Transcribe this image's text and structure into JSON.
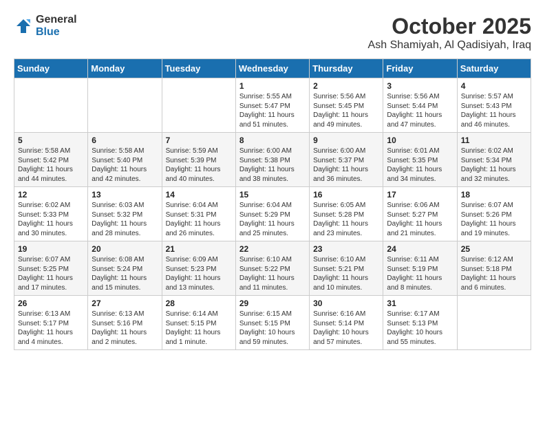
{
  "header": {
    "logo_general": "General",
    "logo_blue": "Blue",
    "month_title": "October 2025",
    "location": "Ash Shamiyah, Al Qadisiyah, Iraq"
  },
  "weekdays": [
    "Sunday",
    "Monday",
    "Tuesday",
    "Wednesday",
    "Thursday",
    "Friday",
    "Saturday"
  ],
  "weeks": [
    [
      {
        "day": "",
        "info": ""
      },
      {
        "day": "",
        "info": ""
      },
      {
        "day": "",
        "info": ""
      },
      {
        "day": "1",
        "info": "Sunrise: 5:55 AM\nSunset: 5:47 PM\nDaylight: 11 hours\nand 51 minutes."
      },
      {
        "day": "2",
        "info": "Sunrise: 5:56 AM\nSunset: 5:45 PM\nDaylight: 11 hours\nand 49 minutes."
      },
      {
        "day": "3",
        "info": "Sunrise: 5:56 AM\nSunset: 5:44 PM\nDaylight: 11 hours\nand 47 minutes."
      },
      {
        "day": "4",
        "info": "Sunrise: 5:57 AM\nSunset: 5:43 PM\nDaylight: 11 hours\nand 46 minutes."
      }
    ],
    [
      {
        "day": "5",
        "info": "Sunrise: 5:58 AM\nSunset: 5:42 PM\nDaylight: 11 hours\nand 44 minutes."
      },
      {
        "day": "6",
        "info": "Sunrise: 5:58 AM\nSunset: 5:40 PM\nDaylight: 11 hours\nand 42 minutes."
      },
      {
        "day": "7",
        "info": "Sunrise: 5:59 AM\nSunset: 5:39 PM\nDaylight: 11 hours\nand 40 minutes."
      },
      {
        "day": "8",
        "info": "Sunrise: 6:00 AM\nSunset: 5:38 PM\nDaylight: 11 hours\nand 38 minutes."
      },
      {
        "day": "9",
        "info": "Sunrise: 6:00 AM\nSunset: 5:37 PM\nDaylight: 11 hours\nand 36 minutes."
      },
      {
        "day": "10",
        "info": "Sunrise: 6:01 AM\nSunset: 5:35 PM\nDaylight: 11 hours\nand 34 minutes."
      },
      {
        "day": "11",
        "info": "Sunrise: 6:02 AM\nSunset: 5:34 PM\nDaylight: 11 hours\nand 32 minutes."
      }
    ],
    [
      {
        "day": "12",
        "info": "Sunrise: 6:02 AM\nSunset: 5:33 PM\nDaylight: 11 hours\nand 30 minutes."
      },
      {
        "day": "13",
        "info": "Sunrise: 6:03 AM\nSunset: 5:32 PM\nDaylight: 11 hours\nand 28 minutes."
      },
      {
        "day": "14",
        "info": "Sunrise: 6:04 AM\nSunset: 5:31 PM\nDaylight: 11 hours\nand 26 minutes."
      },
      {
        "day": "15",
        "info": "Sunrise: 6:04 AM\nSunset: 5:29 PM\nDaylight: 11 hours\nand 25 minutes."
      },
      {
        "day": "16",
        "info": "Sunrise: 6:05 AM\nSunset: 5:28 PM\nDaylight: 11 hours\nand 23 minutes."
      },
      {
        "day": "17",
        "info": "Sunrise: 6:06 AM\nSunset: 5:27 PM\nDaylight: 11 hours\nand 21 minutes."
      },
      {
        "day": "18",
        "info": "Sunrise: 6:07 AM\nSunset: 5:26 PM\nDaylight: 11 hours\nand 19 minutes."
      }
    ],
    [
      {
        "day": "19",
        "info": "Sunrise: 6:07 AM\nSunset: 5:25 PM\nDaylight: 11 hours\nand 17 minutes."
      },
      {
        "day": "20",
        "info": "Sunrise: 6:08 AM\nSunset: 5:24 PM\nDaylight: 11 hours\nand 15 minutes."
      },
      {
        "day": "21",
        "info": "Sunrise: 6:09 AM\nSunset: 5:23 PM\nDaylight: 11 hours\nand 13 minutes."
      },
      {
        "day": "22",
        "info": "Sunrise: 6:10 AM\nSunset: 5:22 PM\nDaylight: 11 hours\nand 11 minutes."
      },
      {
        "day": "23",
        "info": "Sunrise: 6:10 AM\nSunset: 5:21 PM\nDaylight: 11 hours\nand 10 minutes."
      },
      {
        "day": "24",
        "info": "Sunrise: 6:11 AM\nSunset: 5:19 PM\nDaylight: 11 hours\nand 8 minutes."
      },
      {
        "day": "25",
        "info": "Sunrise: 6:12 AM\nSunset: 5:18 PM\nDaylight: 11 hours\nand 6 minutes."
      }
    ],
    [
      {
        "day": "26",
        "info": "Sunrise: 6:13 AM\nSunset: 5:17 PM\nDaylight: 11 hours\nand 4 minutes."
      },
      {
        "day": "27",
        "info": "Sunrise: 6:13 AM\nSunset: 5:16 PM\nDaylight: 11 hours\nand 2 minutes."
      },
      {
        "day": "28",
        "info": "Sunrise: 6:14 AM\nSunset: 5:15 PM\nDaylight: 11 hours\nand 1 minute."
      },
      {
        "day": "29",
        "info": "Sunrise: 6:15 AM\nSunset: 5:15 PM\nDaylight: 10 hours\nand 59 minutes."
      },
      {
        "day": "30",
        "info": "Sunrise: 6:16 AM\nSunset: 5:14 PM\nDaylight: 10 hours\nand 57 minutes."
      },
      {
        "day": "31",
        "info": "Sunrise: 6:17 AM\nSunset: 5:13 PM\nDaylight: 10 hours\nand 55 minutes."
      },
      {
        "day": "",
        "info": ""
      }
    ]
  ]
}
